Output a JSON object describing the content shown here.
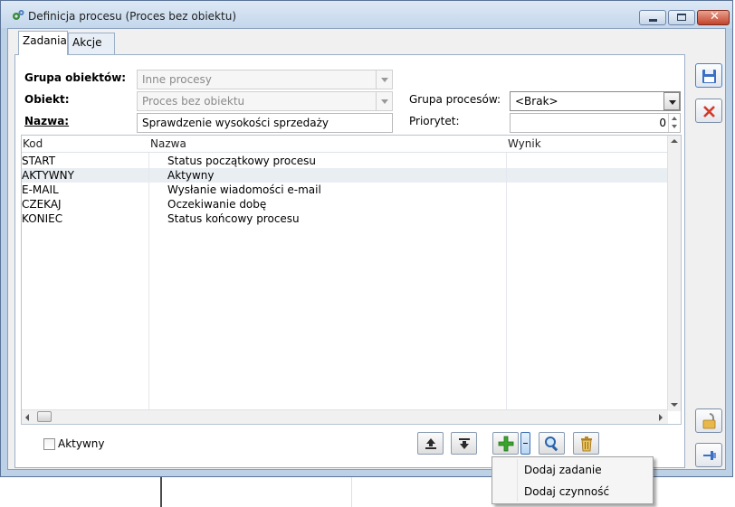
{
  "window": {
    "title": "Definicja procesu (Proces bez obiektu)"
  },
  "tabs": [
    {
      "label": "Zadania",
      "active": true
    },
    {
      "label": "Akcje",
      "active": false
    }
  ],
  "form": {
    "grupa_obiektow": {
      "label": "Grupa obiektów:",
      "value": "Inne procesy"
    },
    "obiekt": {
      "label": "Obiekt:",
      "value": "Proces bez obiektu"
    },
    "nazwa": {
      "label": "Nazwa:",
      "value": "Sprawdzenie wysokości sprzedaży"
    },
    "grupa_procesow": {
      "label": "Grupa procesów:",
      "value": "<Brak>"
    },
    "priorytet": {
      "label": "Priorytet:",
      "value": "0"
    }
  },
  "grid": {
    "columns": [
      "Kod",
      "Nazwa",
      "Wynik"
    ],
    "rows": [
      {
        "kod": "START",
        "nazwa": "Status początkowy procesu",
        "wynik": ""
      },
      {
        "kod": "AKTYWNY",
        "nazwa": "Aktywny",
        "wynik": ""
      },
      {
        "kod": "E-MAIL",
        "nazwa": "Wysłanie wiadomości e-mail",
        "wynik": ""
      },
      {
        "kod": "CZEKAJ",
        "nazwa": "Oczekiwanie dobę",
        "wynik": ""
      },
      {
        "kod": "KONIEC",
        "nazwa": "Status końcowy procesu",
        "wynik": ""
      }
    ],
    "selected_row": 1
  },
  "footer": {
    "aktywny_label": "Aktywny",
    "aktywny_checked": false
  },
  "menu": {
    "items": [
      "Dodaj zadanie",
      "Dodaj czynność"
    ]
  },
  "colors": {
    "frame": "#bcd0e6",
    "add_green": "#3aa52c",
    "delete_red": "#d23a2a",
    "save_blue": "#3b6fc4"
  }
}
